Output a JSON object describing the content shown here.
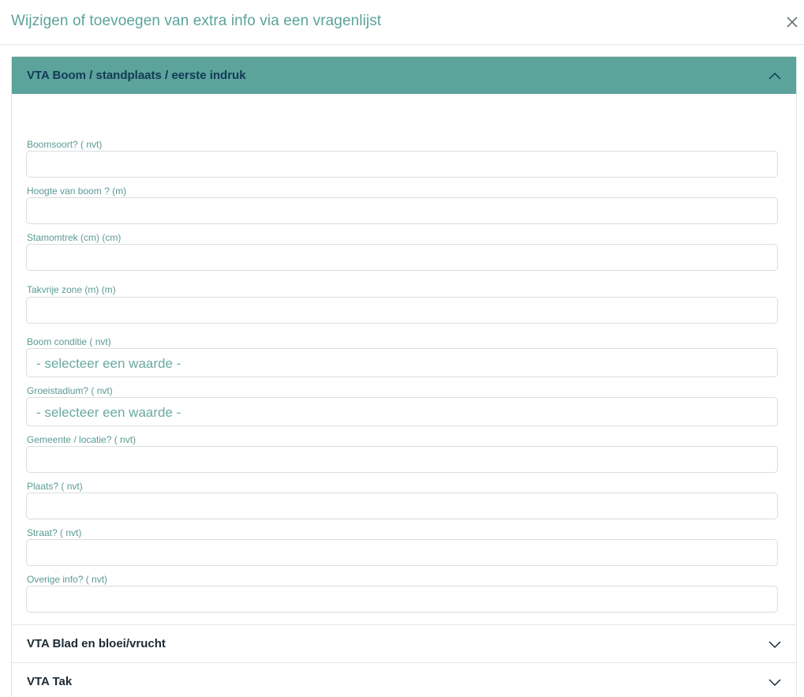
{
  "modal": {
    "title": "Wijzigen of toevoegen van extra info via een vragenlijst",
    "close_icon": "close-icon"
  },
  "colors": {
    "accent": "#5ba39b",
    "header_text": "#123a55",
    "label_text": "#5a9a93"
  },
  "sections": {
    "open": {
      "title": "VTA Boom / standplaats / eerste indruk",
      "icon": "chevron-up-icon",
      "fields": [
        {
          "label": "Boomsoort? ( nvt)",
          "value": ""
        },
        {
          "label": "Hoogte van boom ? (m)",
          "value": ""
        },
        {
          "label": "Stamomtrek (cm) (cm)",
          "value": ""
        },
        {
          "label": "Takvrije zone (m) (m)",
          "value": ""
        },
        {
          "label": "Boom conditie ( nvt)",
          "selected": "- selecteer een waarde -"
        },
        {
          "label": "Groeistadium? ( nvt)",
          "selected": "- selecteer een waarde -"
        },
        {
          "label": "Gemeente / locatie? ( nvt)",
          "value": ""
        },
        {
          "label": "Plaats? ( nvt)",
          "value": ""
        },
        {
          "label": "Straat? ( nvt)",
          "value": ""
        },
        {
          "label": "Overige info? ( nvt)",
          "value": ""
        }
      ]
    },
    "collapsed": [
      {
        "title": "VTA Blad en bloei/vrucht",
        "icon": "chevron-down-icon"
      },
      {
        "title": "VTA Tak",
        "icon": "chevron-down-icon"
      }
    ]
  }
}
